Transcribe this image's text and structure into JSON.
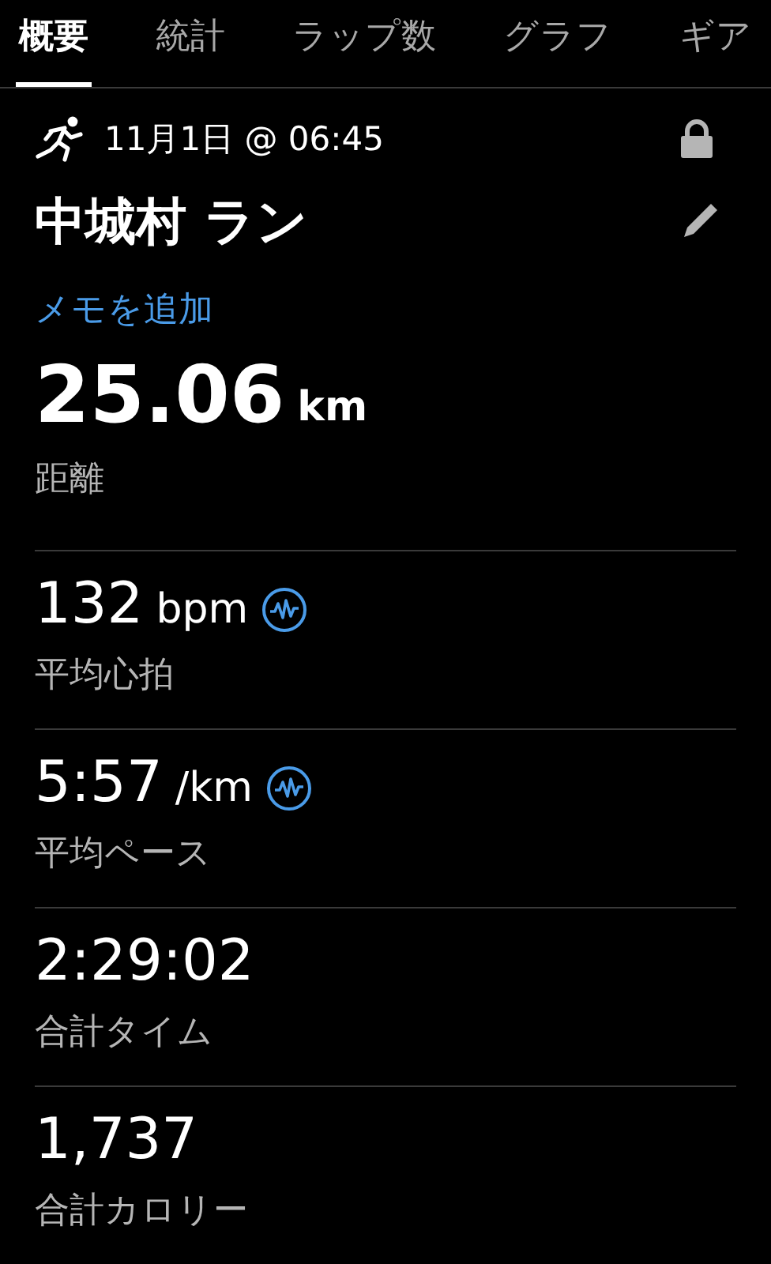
{
  "tabs": [
    {
      "label": "概要",
      "selected": true
    },
    {
      "label": "統計",
      "selected": false
    },
    {
      "label": "ラップ数",
      "selected": false
    },
    {
      "label": "グラフ",
      "selected": false
    },
    {
      "label": "ギア",
      "selected": false
    }
  ],
  "activity": {
    "datetime": "11月1日 @ 06:45",
    "title": "中城村 ラン",
    "memo_link": "メモを追加"
  },
  "stats": [
    {
      "kind": "hero",
      "value": "25.06",
      "unit": "km",
      "label": "距離",
      "chart_icon": false
    },
    {
      "kind": "stat",
      "value": "132",
      "unit": "bpm",
      "label": "平均心拍",
      "chart_icon": true
    },
    {
      "kind": "stat",
      "value": "5:57",
      "unit": "/km",
      "label": "平均ペース",
      "chart_icon": true
    },
    {
      "kind": "stat",
      "value": "2:29:02",
      "label": "合計タイム",
      "chart_icon": false
    },
    {
      "kind": "stat",
      "value": "1,737",
      "label": "合計カロリー",
      "chart_icon": false
    }
  ]
}
